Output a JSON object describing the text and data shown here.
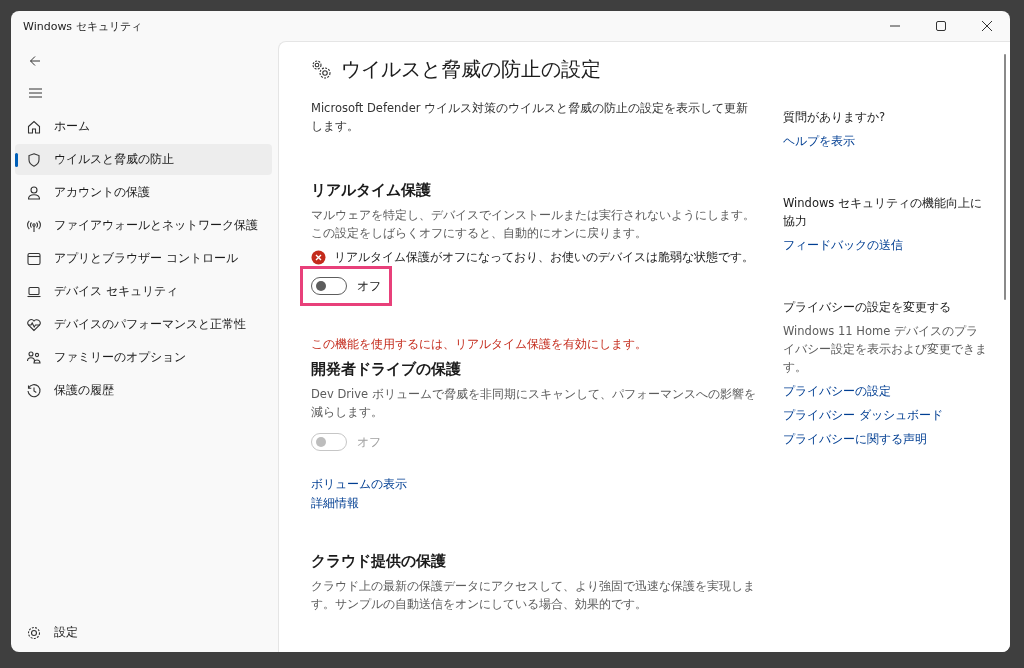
{
  "window": {
    "title": "Windows セキュリティ"
  },
  "sidebar": {
    "items": [
      {
        "label": "ホーム",
        "selected": false
      },
      {
        "label": "ウイルスと脅威の防止",
        "selected": true
      },
      {
        "label": "アカウントの保護",
        "selected": false
      },
      {
        "label": "ファイアウォールとネットワーク保護",
        "selected": false
      },
      {
        "label": "アプリとブラウザー コントロール",
        "selected": false
      },
      {
        "label": "デバイス セキュリティ",
        "selected": false
      },
      {
        "label": "デバイスのパフォーマンスと正常性",
        "selected": false
      },
      {
        "label": "ファミリーのオプション",
        "selected": false
      },
      {
        "label": "保護の履歴",
        "selected": false
      }
    ],
    "footer": {
      "label": "設定"
    }
  },
  "page": {
    "title": "ウイルスと脅威の防止の設定",
    "description": "Microsoft Defender ウイルス対策のウイルスと脅威の防止の設定を表示して更新します。",
    "sections": [
      {
        "heading": "リアルタイム保護",
        "description": "マルウェアを特定し、デバイスでインストールまたは実行されないようにします。この設定をしばらくオフにすると、自動的にオンに戻ります。",
        "alert": "リアルタイム保護がオフになっており、お使いのデバイスは脆弱な状態です。",
        "toggle": {
          "label": "オフ",
          "on": false,
          "disabled": false,
          "highlighted": true
        }
      },
      {
        "requirement": "この機能を使用するには、リアルタイム保護を有効にします。",
        "heading": "開発者ドライブの保護",
        "description": "Dev Drive ボリュームで脅威を非同期にスキャンして、パフォーマンスへの影響を減らします。",
        "toggle": {
          "label": "オフ",
          "on": false,
          "disabled": true,
          "highlighted": false
        },
        "links": [
          "ボリュームの表示",
          "詳細情報"
        ]
      },
      {
        "heading": "クラウド提供の保護",
        "description": "クラウド上の最新の保護データにアクセスして、より強固で迅速な保護を実現します。サンプルの自動送信をオンにしている場合、効果的です。"
      }
    ]
  },
  "aside": [
    {
      "heading": "質問がありますか?",
      "links": [
        "ヘルプを表示"
      ]
    },
    {
      "heading": "Windows セキュリティの機能向上に協力",
      "links": [
        "フィードバックの送信"
      ]
    },
    {
      "heading": "プライバシーの設定を変更する",
      "text": "Windows 11 Home デバイスのプライバシー設定を表示および変更できます。",
      "links": [
        "プライバシーの設定",
        "プライバシー ダッシュボード",
        "プライバシーに関する声明"
      ]
    }
  ]
}
